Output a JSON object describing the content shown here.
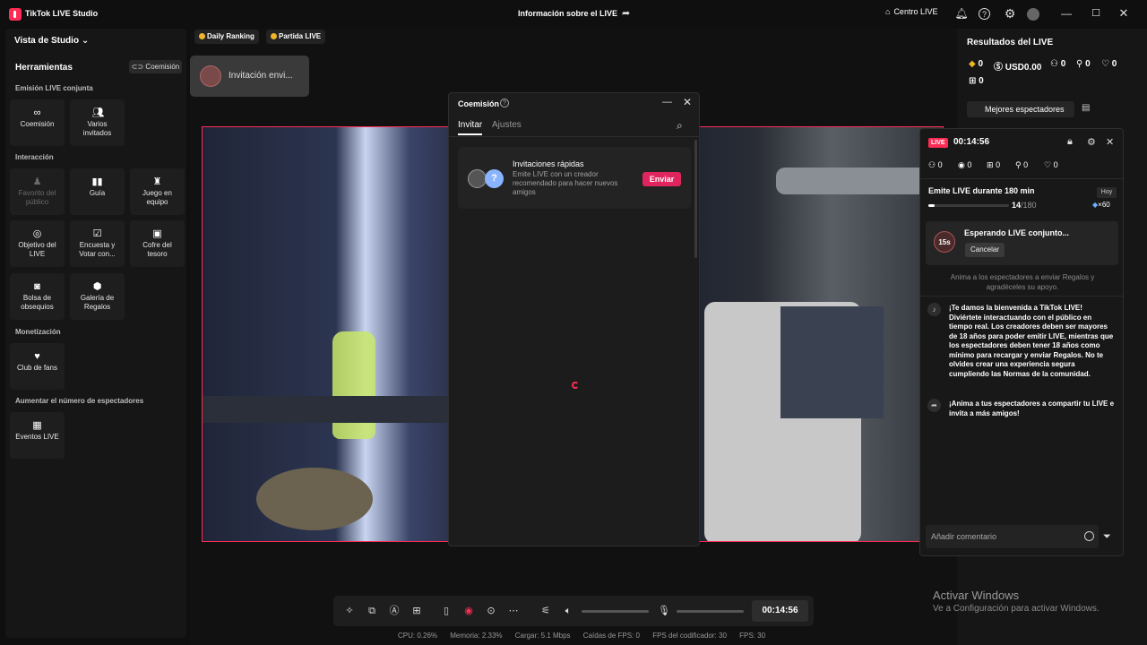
{
  "app": {
    "name": "TikTok LIVE Studio",
    "center_title": "Información sobre el LIVE",
    "centro_label": "Centro LIVE"
  },
  "left": {
    "view_label": "Vista de Studio",
    "tools_title": "Herramientas",
    "coemision_btn": "Coemisión",
    "sections": {
      "joint": "Emisión LIVE conjunta",
      "interaction": "Interacción",
      "monetization": "Monetización",
      "grow": "Aumentar el número de espectadores"
    },
    "tiles": {
      "coemision": "Coemisión",
      "varios": "Varios invitados",
      "favorito": "Favorito del público",
      "guia": "Guía",
      "juego": "Juego en equipo",
      "objetivo": "Objetivo del LIVE",
      "encuesta": "Encuesta y Votar con...",
      "cofre": "Cofre del tesoro",
      "bolsa": "Bolsa de obsequios",
      "galeria": "Galería de Regalos",
      "club": "Club de fans",
      "eventos": "Eventos LIVE"
    }
  },
  "stage": {
    "pills": [
      "Daily Ranking",
      "Partida LIVE"
    ],
    "invite_popup": "Invitación envi..."
  },
  "dialog": {
    "title": "Coemisión",
    "tabs": [
      "Invitar",
      "Ajustes"
    ],
    "card_title": "Invitaciones rápidas",
    "card_desc": "Emite LIVE con un creador recomendado para hacer nuevos amigos",
    "send": "Enviar"
  },
  "toolbar": {
    "time": "00:14:56",
    "volume_level": 0.0,
    "mic_level": 0.0
  },
  "stats": {
    "cpu": "CPU:  0.26%",
    "mem": "Memoria:  2.33%",
    "load": "Cargar:  5.1 Mbps",
    "drops": "Caídas de FPS:  0",
    "enc": "FPS del codificador:  30",
    "fps": "FPS:  30"
  },
  "right": {
    "title": "Resultados del LIVE",
    "stats": [
      "0",
      "USD0.00",
      "0",
      "0",
      "0",
      "0"
    ],
    "mejores": "Mejores espectadores",
    "activate1": "Activar Windows",
    "activate2": "Ve a Configuración para activar Windows."
  },
  "live": {
    "badge": "LIVE",
    "time": "00:14:56",
    "stats": [
      "0",
      "0",
      "0",
      "0",
      "0"
    ],
    "emit_title": "Emite LIVE durante 180 min",
    "hoy": "Hoy",
    "progress_num": "14",
    "progress_den": "/180",
    "progress_fraction": 0.078,
    "gems": "×60",
    "waiting_avatar": "15s",
    "waiting_title": "Esperando LIVE conjunto...",
    "cancel": "Cancelar",
    "anima": "Anima a los espectadores a enviar Regalos y agradéceles su apoyo.",
    "msg1": "¡Te damos la bienvenida a TikTok LIVE! Diviértete interactuando con el público en tiempo real. Los creadores deben ser mayores de 18 años para poder emitir LIVE, mientras que los espectadores deben tener 18 años como mínimo para recargar y enviar Regalos. No te olvides crear una experiencia segura cumpliendo las Normas de la comunidad.",
    "msg2": "¡Anima a tus espectadores a compartir tu LIVE e invita a más amigos!",
    "comment_ph": "Añadir comentario"
  },
  "colors": {
    "accent": "#fe2c55",
    "panel": "#161616",
    "bg": "#0f0f0f"
  }
}
